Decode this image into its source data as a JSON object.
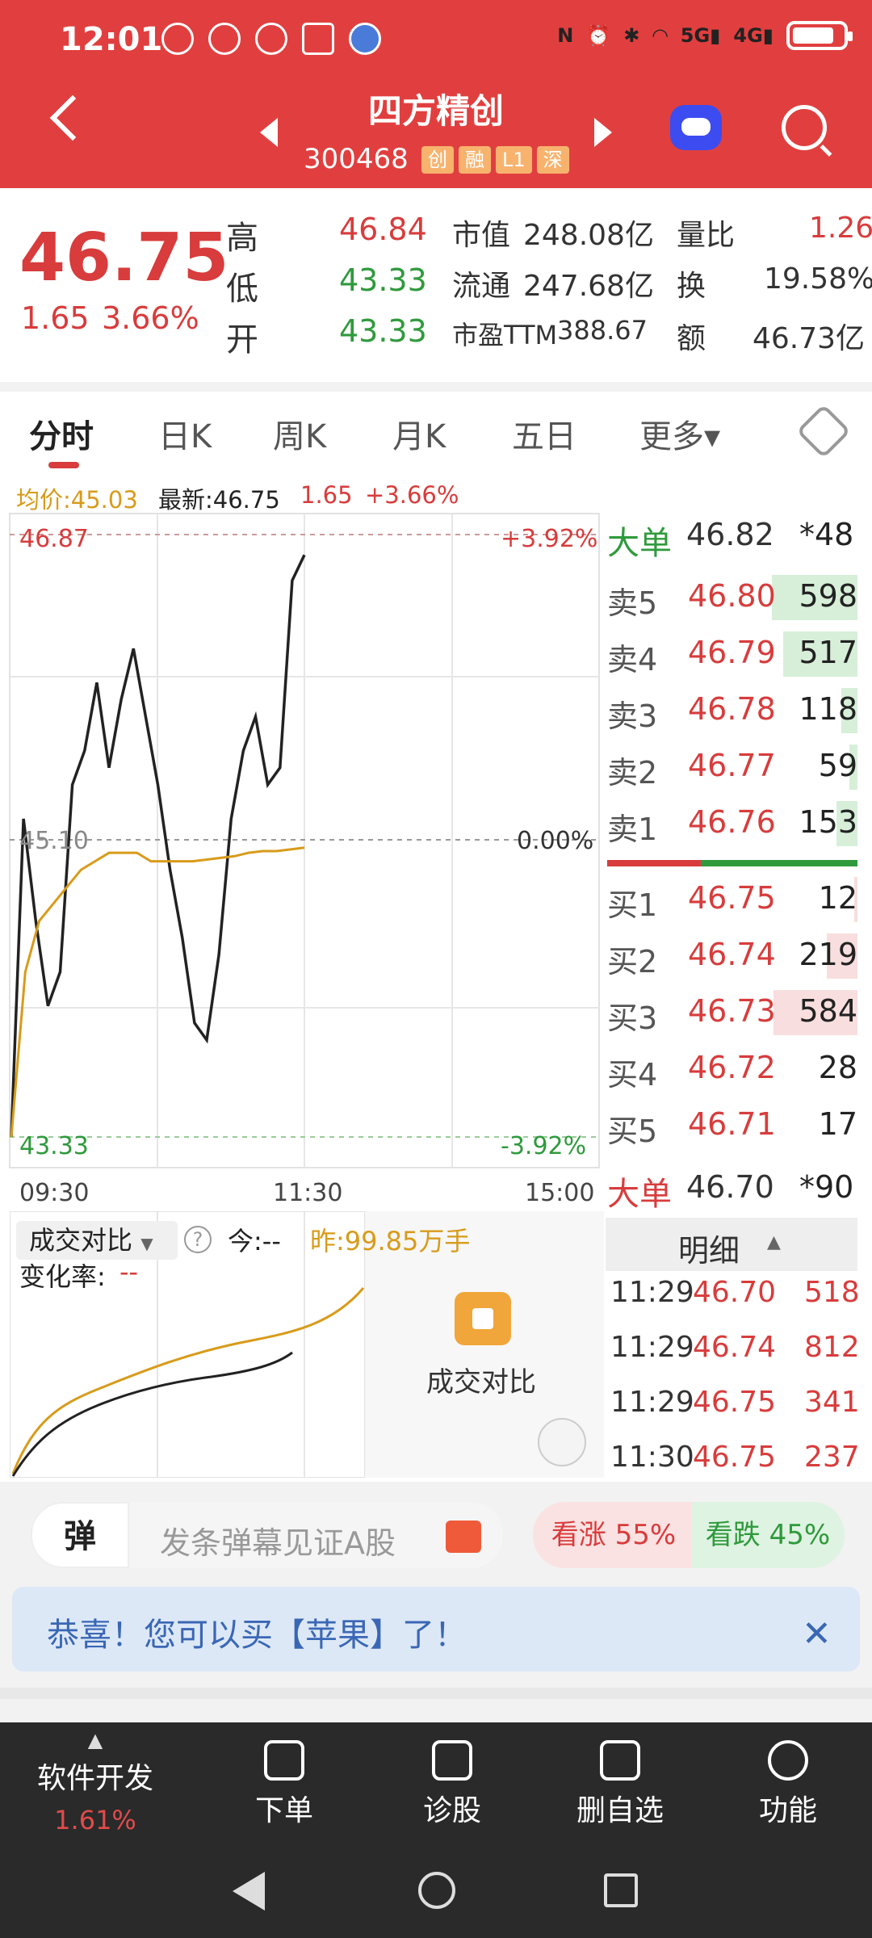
{
  "status": {
    "time": "12:01"
  },
  "header": {
    "name": "四方精创",
    "code": "300468",
    "tags": [
      "创",
      "融",
      "L1",
      "深"
    ]
  },
  "quote": {
    "price": "46.75",
    "change": "1.65",
    "change_pct": "3.66%",
    "high_label": "高",
    "high": "46.84",
    "low_label": "低",
    "low": "43.33",
    "open_label": "开",
    "open": "43.33",
    "mcap_label": "市值",
    "mcap": "248.08亿",
    "float_label": "流通",
    "float": "247.68亿",
    "pe_label": "市盈TTM",
    "pe": "388.67",
    "vr_label": "量比",
    "vr": "1.26",
    "turn_label": "换",
    "turn": "19.58%",
    "amt_label": "额",
    "amt": "46.73亿"
  },
  "tabs": [
    "分时",
    "日K",
    "周K",
    "月K",
    "五日",
    "更多▾"
  ],
  "chart_info": {
    "avg_label": "均价:45.03",
    "last_label": "最新:46.75",
    "chg": "1.65",
    "chg_pct": "+3.66%"
  },
  "chart_axis": {
    "top_price": "46.87",
    "top_pct": "+3.92%",
    "mid_price": "45.10",
    "mid_pct": "0.00%",
    "bot_price": "43.33",
    "bot_pct": "-3.92%",
    "time_start": "09:30",
    "time_mid": "11:30",
    "time_end": "15:00"
  },
  "chart_data": {
    "type": "line",
    "x_label": "time",
    "ylim": [
      43.33,
      46.87
    ],
    "series": [
      {
        "name": "price",
        "values": [
          43.33,
          45.2,
          44.6,
          44.1,
          44.3,
          45.4,
          45.6,
          46.0,
          45.5,
          45.9,
          46.2,
          45.8,
          45.4,
          44.9,
          44.5,
          44.0,
          43.9,
          44.4,
          45.2,
          45.6,
          45.8,
          45.4,
          45.5,
          46.6,
          46.75
        ]
      },
      {
        "name": "avg",
        "values": [
          43.33,
          44.3,
          44.6,
          44.7,
          44.8,
          44.9,
          44.95,
          45.0,
          45.0,
          45.0,
          44.95,
          44.95,
          44.95,
          44.95,
          44.96,
          44.97,
          44.98,
          45.0,
          45.01,
          45.01,
          45.02,
          45.03
        ]
      }
    ]
  },
  "orderbook": {
    "big_sell_label": "大单",
    "big_sell_price": "46.82",
    "big_sell_vol": "*48",
    "asks": [
      {
        "label": "卖5",
        "price": "46.80",
        "vol": "598"
      },
      {
        "label": "卖4",
        "price": "46.79",
        "vol": "517"
      },
      {
        "label": "卖3",
        "price": "46.78",
        "vol": "118"
      },
      {
        "label": "卖2",
        "price": "46.77",
        "vol": "59"
      },
      {
        "label": "卖1",
        "price": "46.76",
        "vol": "153"
      }
    ],
    "bids": [
      {
        "label": "买1",
        "price": "46.75",
        "vol": "12"
      },
      {
        "label": "买2",
        "price": "46.74",
        "vol": "219"
      },
      {
        "label": "买3",
        "price": "46.73",
        "vol": "584"
      },
      {
        "label": "买4",
        "price": "46.72",
        "vol": "28"
      },
      {
        "label": "买5",
        "price": "46.71",
        "vol": "17"
      }
    ],
    "big_buy_label": "大单",
    "big_buy_price": "46.70",
    "big_buy_vol": "*90",
    "detail_label": "明细",
    "trades": [
      {
        "time": "11:29",
        "price": "46.70",
        "vol": "518"
      },
      {
        "time": "11:29",
        "price": "46.74",
        "vol": "812"
      },
      {
        "time": "11:29",
        "price": "46.75",
        "vol": "341"
      },
      {
        "time": "11:30",
        "price": "46.75",
        "vol": "237"
      }
    ]
  },
  "volume_compare": {
    "dropdown": "成交对比",
    "today": "今:--",
    "yesterday": "昨:99.85万手",
    "rate": "变化率:",
    "rate_val": "--",
    "locked_label": "成交对比"
  },
  "danmu": {
    "icon": "弹",
    "placeholder": "发条弹幕见证A股",
    "up": "看涨 55%",
    "down": "看跌 45%"
  },
  "notice": {
    "text": "恭喜！您可以买【苹果】了！"
  },
  "toolbar": {
    "sector": "软件开发",
    "sector_pct": "1.61%",
    "order": "下单",
    "diag": "诊股",
    "del": "删自选",
    "func": "功能"
  }
}
